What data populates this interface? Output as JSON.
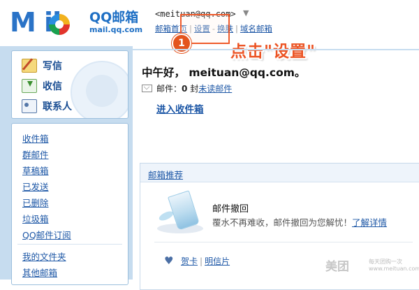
{
  "header": {
    "logo_text": "M  il",
    "brand_name": "QQ邮箱",
    "brand_domain": "mail.qq.com",
    "user_email": "<meituan@qq.com>",
    "links": [
      "邮箱首页",
      "设置",
      "换肤",
      "域名邮箱"
    ]
  },
  "annotation": {
    "step": "1",
    "callout": "点击\"设置\""
  },
  "sidebar": {
    "actions": [
      {
        "label": "写信",
        "icon": "write-icon"
      },
      {
        "label": "收信",
        "icon": "inbox-icon"
      },
      {
        "label": "联系人",
        "icon": "contacts-icon"
      }
    ],
    "folders": [
      "收件箱",
      "群邮件",
      "草稿箱",
      "已发送",
      "已删除",
      "垃圾箱",
      "QQ邮件订阅"
    ],
    "folders2": [
      "我的文件夹",
      "其他邮箱"
    ]
  },
  "main": {
    "greeting": "中午好， meituan@qq.com。",
    "mail_prefix": "邮件：",
    "mail_count": "0",
    "mail_unit": "封",
    "unread_link": "未读邮件",
    "inbox_link": "进入收件箱"
  },
  "recommend": {
    "title": "邮箱推荐",
    "item_title": "邮件撤回",
    "item_desc": "覆水不再难收，邮件撤回为您解忧！",
    "item_link": "了解详情",
    "links": [
      "贺卡",
      "明信片"
    ]
  },
  "watermark": {
    "brand": "美团",
    "slogan": "每天团购一次",
    "url": "www.meituan.com"
  }
}
